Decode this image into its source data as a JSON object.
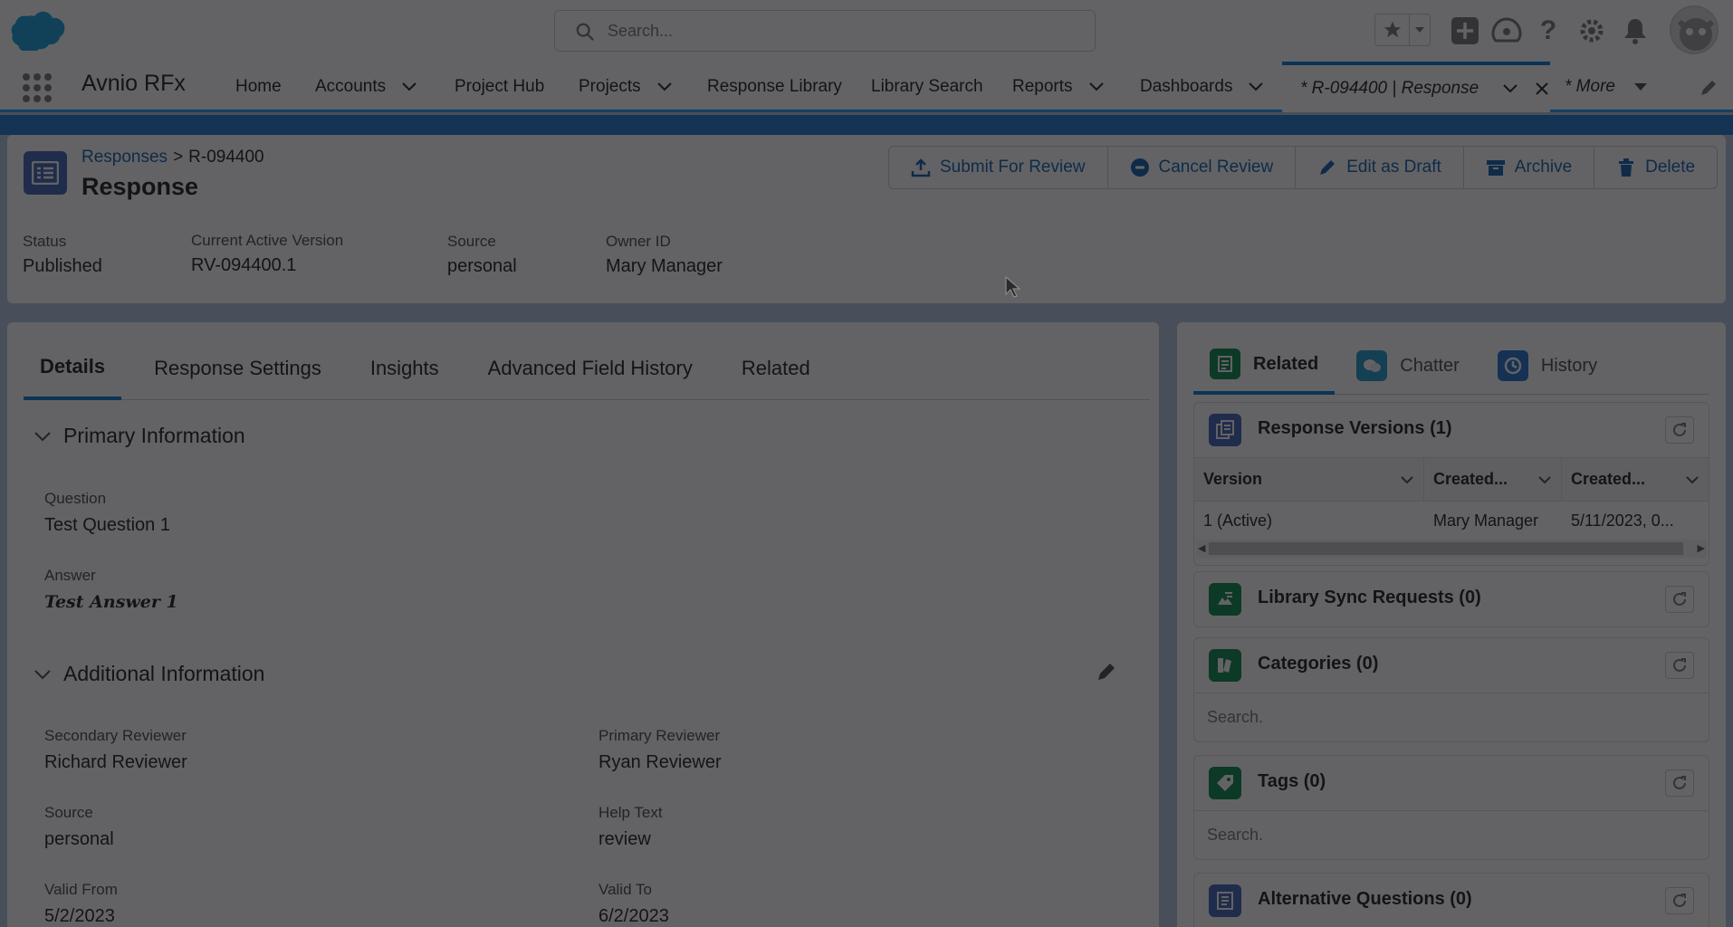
{
  "header": {
    "search_placeholder": "Search..."
  },
  "nav": {
    "app_name": "Avnio RFx",
    "items": [
      {
        "label": "Home",
        "has_menu": false
      },
      {
        "label": "Accounts",
        "has_menu": true
      },
      {
        "label": "Project Hub",
        "has_menu": false
      },
      {
        "label": "Projects",
        "has_menu": true
      },
      {
        "label": "Response Library",
        "has_menu": false
      },
      {
        "label": "Library Search",
        "has_menu": false
      },
      {
        "label": "Reports",
        "has_menu": true
      },
      {
        "label": "Dashboards",
        "has_menu": true
      }
    ],
    "active_tab": "* R-094400 | Response",
    "more_label": "* More"
  },
  "record": {
    "breadcrumb_parent": "Responses",
    "breadcrumb_sep": ">",
    "breadcrumb_current": "R-094400",
    "title": "Response",
    "actions": [
      "Submit For Review",
      "Cancel Review",
      "Edit as Draft",
      "Archive",
      "Delete"
    ],
    "highlights": {
      "status_label": "Status",
      "status_value": "Published",
      "version_label": "Current Active Version",
      "version_value": "RV-094400.1",
      "source_label": "Source",
      "source_value": "personal",
      "owner_label": "Owner ID",
      "owner_value": "Mary Manager"
    }
  },
  "details": {
    "tabs": [
      "Details",
      "Response Settings",
      "Insights",
      "Advanced Field History",
      "Related"
    ],
    "primary_section": "Primary Information",
    "question_label": "Question",
    "question_value": "Test Question 1",
    "answer_label": "Answer",
    "answer_value": "Test Answer 1",
    "additional_section": "Additional Information",
    "secondary_reviewer_label": "Secondary Reviewer",
    "secondary_reviewer_value": "Richard Reviewer",
    "primary_reviewer_label": "Primary Reviewer",
    "primary_reviewer_value": "Ryan Reviewer",
    "source_label": "Source",
    "source_value": "personal",
    "help_text_label": "Help Text",
    "help_text_value": "review",
    "valid_from_label": "Valid From",
    "valid_from_value": "5/2/2023",
    "valid_to_label": "Valid To",
    "valid_to_value": "6/2/2023"
  },
  "related": {
    "tabs": [
      "Related",
      "Chatter",
      "History"
    ],
    "response_versions": {
      "title": "Response Versions (1)",
      "columns": [
        "Version",
        "Created...",
        "Created..."
      ],
      "rows": [
        [
          "1 (Active)",
          "Mary Manager",
          "5/11/2023, 0..."
        ]
      ]
    },
    "library_sync": {
      "title": "Library Sync Requests (0)"
    },
    "categories": {
      "title": "Categories (0)",
      "search_placeholder": "Search."
    },
    "tags": {
      "title": "Tags (0)",
      "search_placeholder": "Search."
    },
    "alternative_questions": {
      "title": "Alternative Questions (0)"
    }
  },
  "colors": {
    "brand_blue": "#0176d3",
    "link": "#0b5cab",
    "record_icon": "#3c5eb3",
    "related_green": "#04844b",
    "overlay": "rgba(18,18,22,0.66)"
  }
}
